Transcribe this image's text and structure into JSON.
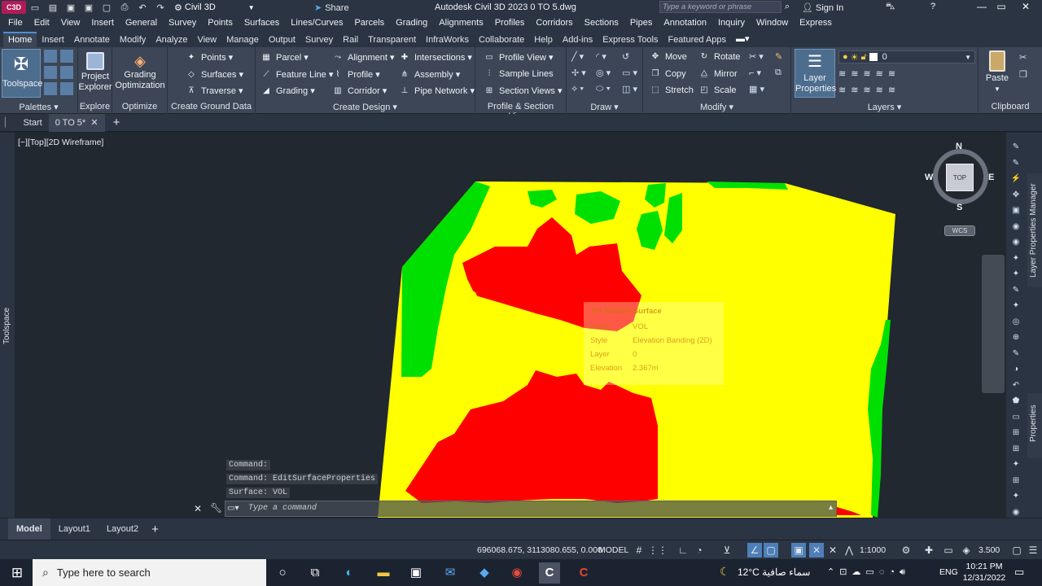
{
  "titlebar": {
    "app_badge": "C3D",
    "workspace": "Civil 3D",
    "share_label": "Share",
    "window_title": "Autodesk Civil 3D 2023    0 TO 5.dwg",
    "search_placeholder": "Type a keyword or phrase",
    "signin_label": "Sign In"
  },
  "menubar": [
    "File",
    "Edit",
    "View",
    "Insert",
    "General",
    "Survey",
    "Points",
    "Surfaces",
    "Lines/Curves",
    "Parcels",
    "Grading",
    "Alignments",
    "Profiles",
    "Corridors",
    "Sections",
    "Pipes",
    "Annotation",
    "Inquiry",
    "Window",
    "Express"
  ],
  "ribbon_tabs": [
    "Home",
    "Insert",
    "Annotate",
    "Modify",
    "Analyze",
    "View",
    "Manage",
    "Output",
    "Survey",
    "Rail",
    "Transparent",
    "InfraWorks",
    "Collaborate",
    "Help",
    "Add-ins",
    "Express Tools",
    "Featured Apps"
  ],
  "ribbon": {
    "toolspace": "Toolspace",
    "project_explorer": "Project Explorer",
    "grading_optimization": "Grading Optimization",
    "panels": {
      "palettes": "Palettes",
      "explore": "Explore",
      "optimize": "Optimize",
      "create_ground_data": "Create Ground Data",
      "create_design": "Create Design",
      "profile_section_views": "Profile & Section Views",
      "draw": "Draw",
      "modify": "Modify",
      "layers": "Layers",
      "clipboard": "Clipboard"
    },
    "ground": [
      "Points",
      "Surfaces",
      "Traverse"
    ],
    "design_col1": [
      "Parcel",
      "Feature Line",
      "Grading"
    ],
    "design_col2": [
      "Alignment",
      "Profile",
      "Corridor"
    ],
    "design_col3": [
      "Intersections",
      "Assembly",
      "Pipe Network"
    ],
    "views": [
      "Profile View",
      "Sample Lines",
      "Section Views"
    ],
    "modify_col1": [
      "Move",
      "Copy",
      "Stretch"
    ],
    "modify_col2": [
      "Rotate",
      "Mirror",
      "Scale"
    ],
    "layer_props": "Layer Properties",
    "layer_current": "0",
    "paste": "Paste"
  },
  "doc_tabs": {
    "start": "Start",
    "current": "0 TO 5*"
  },
  "viewport": {
    "label": "[−][Top][2D Wireframe]",
    "compass": {
      "n": "N",
      "s": "S",
      "e": "E",
      "w": "W",
      "top": "TOP",
      "ucs": "WCS"
    },
    "tooltip": {
      "title": "Tin Volume Surface",
      "rows": [
        {
          "k": "Name",
          "v": "VOL"
        },
        {
          "k": "Style",
          "v": "Elevation Banding (2D)"
        },
        {
          "k": "Layer",
          "v": "0"
        },
        {
          "k": "Elevation",
          "v": "2.367m"
        }
      ]
    }
  },
  "side_labels": {
    "left": "Toolspace",
    "right1": "Layer Properties Manager",
    "right2": "Properties"
  },
  "command": {
    "history": [
      "Command:",
      "Command: EditSurfaceProperties",
      "Surface:  VOL"
    ],
    "placeholder": "Type a command"
  },
  "layout_tabs": [
    "Model",
    "Layout1",
    "Layout2"
  ],
  "status": {
    "coords": "696068.675, 3113080.655, 0.000",
    "mode": "MODEL",
    "scale": "1:1000",
    "value": "3.500"
  },
  "taskbar": {
    "search": "Type here to search",
    "weather": "12°C  سماء صافية",
    "lang": "ENG",
    "time": "10:21 PM",
    "date": "12/31/2022"
  },
  "colors": {
    "cut": "#ff0000",
    "band": "#ffff00",
    "fill": "#00e000",
    "bg": "#212830"
  }
}
